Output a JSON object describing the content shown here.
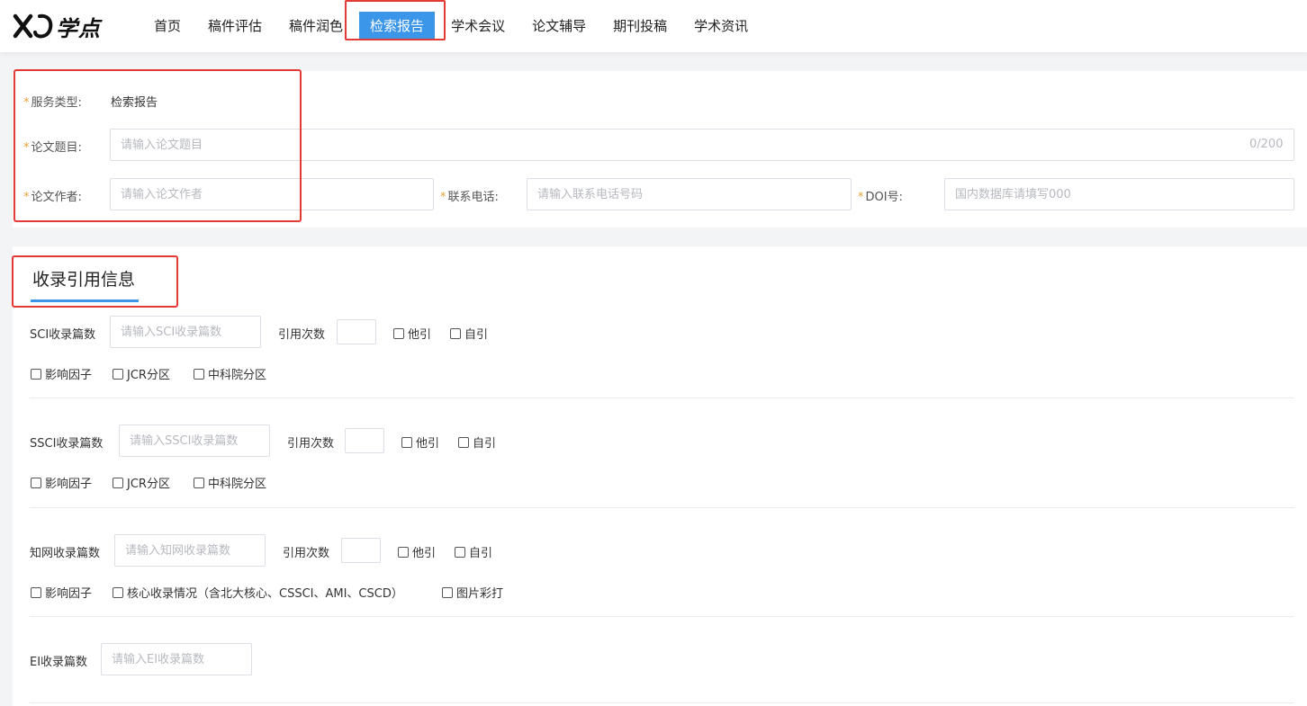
{
  "header": {
    "logo_text": "学点",
    "nav": [
      {
        "label": "首页"
      },
      {
        "label": "稿件评估"
      },
      {
        "label": "稿件润色"
      },
      {
        "label": "检索报告",
        "active": true
      },
      {
        "label": "学术会议"
      },
      {
        "label": "论文辅导"
      },
      {
        "label": "期刊投稿"
      },
      {
        "label": "学术资讯"
      }
    ],
    "active_color": "#3b95e9"
  },
  "form": {
    "required_mark": "*",
    "service_type": {
      "label": "服务类型:",
      "value": "检索报告"
    },
    "title": {
      "label": "论文题目:",
      "placeholder": "请输入论文题目",
      "counter": "0/200"
    },
    "author": {
      "label": "论文作者:",
      "placeholder": "请输入论文作者"
    },
    "phone": {
      "label": "联系电话:",
      "placeholder": "请输入联系电话号码"
    },
    "doi": {
      "label": "DOI号:",
      "placeholder": "国内数据库请填写000"
    }
  },
  "citation": {
    "section_title": "收录引用信息",
    "sci": {
      "count_label": "SCI收录篇数",
      "count_placeholder": "请输入SCI收录篇数",
      "cite_label": "引用次数",
      "other_cite": "他引",
      "self_cite": "自引",
      "options": [
        "影响因子",
        "JCR分区",
        "中科院分区"
      ]
    },
    "ssci": {
      "count_label": "SSCI收录篇数",
      "count_placeholder": "请输入SSCI收录篇数",
      "cite_label": "引用次数",
      "other_cite": "他引",
      "self_cite": "自引",
      "options": [
        "影响因子",
        "JCR分区",
        "中科院分区"
      ]
    },
    "cnki": {
      "count_label": "知网收录篇数",
      "count_placeholder": "请输入知网收录篇数",
      "cite_label": "引用次数",
      "other_cite": "他引",
      "self_cite": "自引",
      "options": [
        "影响因子",
        "核心收录情况（含北大核心、CSSCI、AMI、CSCD）",
        "图片彩打"
      ]
    },
    "ei": {
      "count_label": "EI收录篇数",
      "count_placeholder": "请输入EI收录篇数"
    }
  },
  "colors": {
    "highlight": "#e53935",
    "accent": "#3b95e9",
    "required": "#e6a23c"
  }
}
